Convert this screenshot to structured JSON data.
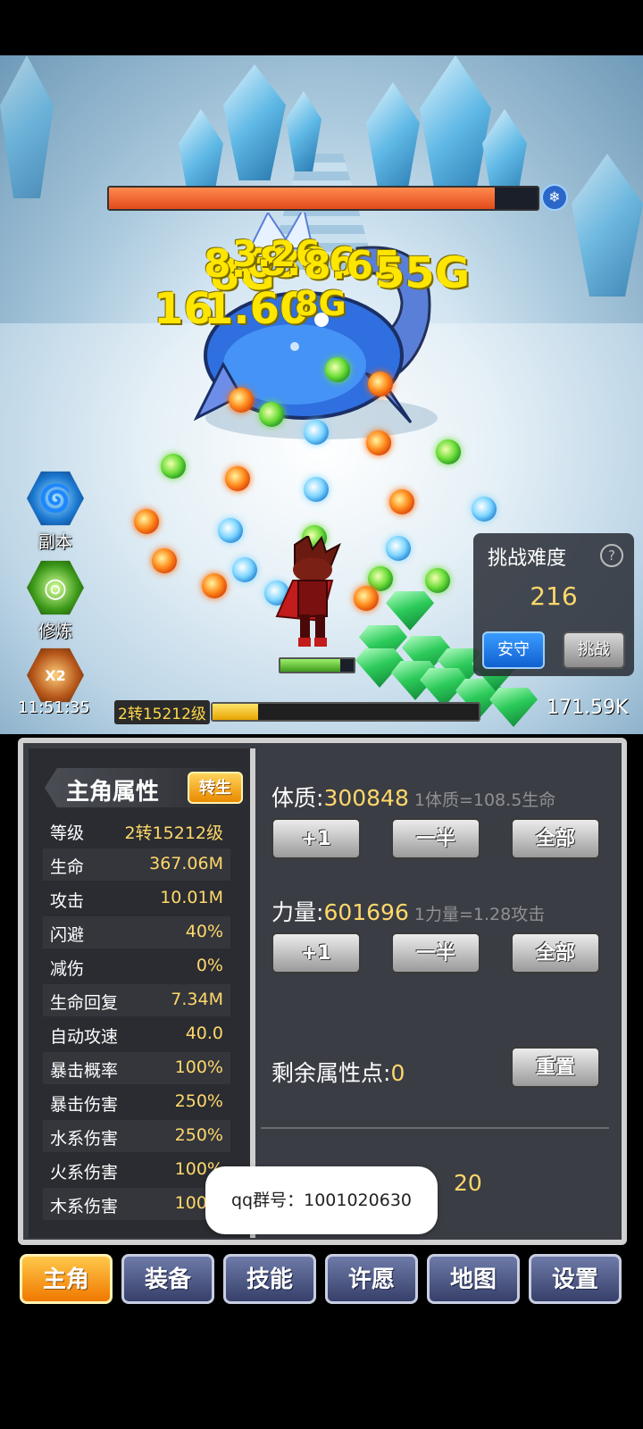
{
  "boss": {
    "hp_fraction": 0.9,
    "damage_numbers": [
      "8G",
      "8.03",
      "8.06",
      "G",
      "8.65",
      "3.26",
      "55G",
      "16",
      "1.60",
      "8G"
    ]
  },
  "side_menu": [
    {
      "label": "副本",
      "icon": "vortex-icon"
    },
    {
      "label": "修炼",
      "icon": "cultivation-icon"
    },
    {
      "label": "",
      "icon": "x2-bag-icon",
      "badge": "X2"
    }
  ],
  "timer": "11:51:35",
  "challenge": {
    "title": "挑战难度",
    "value": "216",
    "guard_label": "安守",
    "challenge_label": "挑战"
  },
  "level": {
    "label": "2转15212级",
    "progress": 0.17
  },
  "gold": "171.59K",
  "hero": {
    "hp_fraction": 0.82
  },
  "attributes_panel": {
    "title": "主角属性",
    "rebirth_label": "转生",
    "stats": [
      {
        "name": "等级",
        "value": "2转15212级"
      },
      {
        "name": "生命",
        "value": "367.06M"
      },
      {
        "name": "攻击",
        "value": "10.01M"
      },
      {
        "name": "闪避",
        "value": "40%"
      },
      {
        "name": "减伤",
        "value": "0%"
      },
      {
        "name": "生命回复",
        "value": "7.34M"
      },
      {
        "name": "自动攻速",
        "value": "40.0"
      },
      {
        "name": "暴击概率",
        "value": "100%"
      },
      {
        "name": "暴击伤害",
        "value": "250%"
      },
      {
        "name": "水系伤害",
        "value": "250%"
      },
      {
        "name": "火系伤害",
        "value": "100%"
      },
      {
        "name": "木系伤害",
        "value": "100%"
      }
    ]
  },
  "stats_allocation": {
    "constitution": {
      "label": "体质:",
      "value": "300848",
      "hint": "1体质=108.5生命"
    },
    "strength": {
      "label": "力量:",
      "value": "601696",
      "hint": "1力量=1.28攻击"
    },
    "buttons": {
      "plus_one": "+1",
      "half": "一半",
      "all": "全部"
    },
    "remaining": {
      "label": "剩余属性点:",
      "value": "0"
    },
    "reset_label": "重置",
    "auto_attack_value": "20"
  },
  "toast": "qq群号：1001020630",
  "tabs": [
    {
      "label": "主角",
      "active": true
    },
    {
      "label": "装备",
      "active": false
    },
    {
      "label": "技能",
      "active": false
    },
    {
      "label": "许愿",
      "active": false
    },
    {
      "label": "地图",
      "active": false
    },
    {
      "label": "设置",
      "active": false
    }
  ],
  "colors": {
    "accent_gold": "#ffd86a",
    "active_tab": "#f07800",
    "inactive_tab": "#36406a"
  }
}
